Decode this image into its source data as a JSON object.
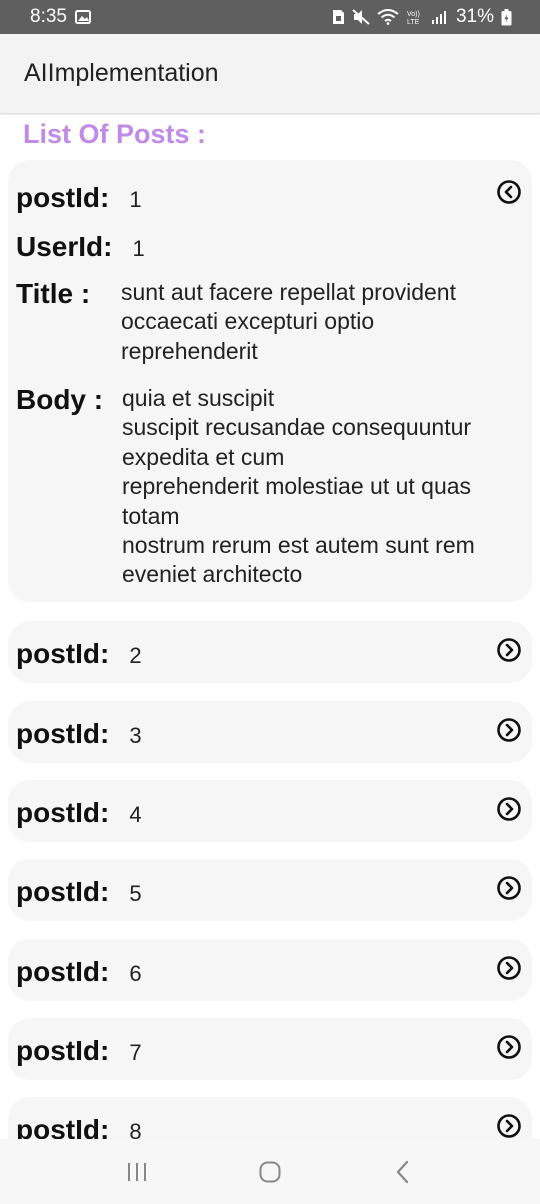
{
  "status_bar": {
    "time": "8:35",
    "battery": "31%"
  },
  "app_bar": {
    "title": "AIImplementation"
  },
  "section": {
    "title": "List Of Posts :"
  },
  "labels": {
    "post_id": "postId:",
    "user_id": "UserId:",
    "title": "Title :",
    "body": "Body :"
  },
  "expanded_post": {
    "post_id": "1",
    "user_id": "1",
    "title": "sunt aut facere repellat provident\noccaecati excepturi optio\nreprehenderit",
    "body": "quia et suscipit\nsuscipit recusandae consequuntur\nexpedita et cum\nreprehenderit molestiae ut ut quas\ntotam\nnostrum rerum est autem sunt rem\neveniet architecto"
  },
  "collapsed_posts": [
    {
      "post_id": "2"
    },
    {
      "post_id": "3"
    },
    {
      "post_id": "4"
    },
    {
      "post_id": "5"
    },
    {
      "post_id": "6"
    },
    {
      "post_id": "7"
    },
    {
      "post_id": "8"
    }
  ],
  "icons": {
    "expanded": "chevron-left-circle-icon",
    "collapsed": "chevron-right-circle-icon"
  }
}
